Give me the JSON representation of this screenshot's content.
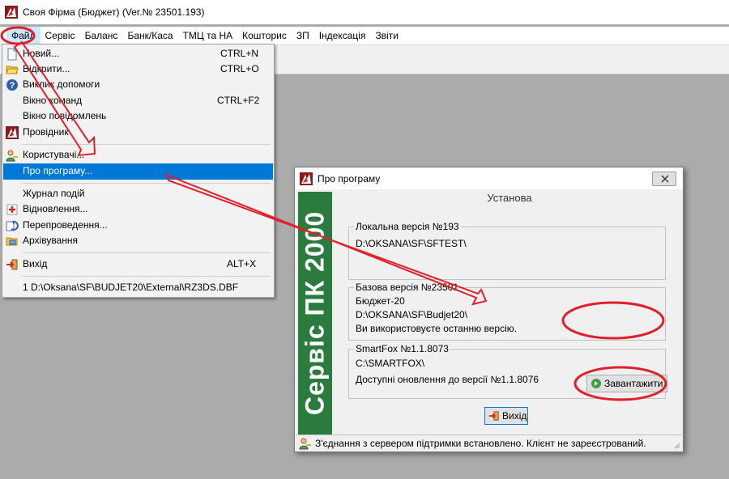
{
  "colors": {
    "highlight": "#0078d7",
    "banner_green": "#2b7a3e",
    "annotation_red": "#e0202a",
    "background": "#ababab"
  },
  "window": {
    "title": "Своя Фірма (Бюджет) (Ver.№ 23501.193)",
    "icon": "app-logo-icon"
  },
  "menubar": {
    "items": [
      {
        "label": "Файл",
        "active": true
      },
      {
        "label": "Сервіс"
      },
      {
        "label": "Баланс"
      },
      {
        "label": "Банк/Каса"
      },
      {
        "label": "ТМЦ та НА"
      },
      {
        "label": "Кошторис"
      },
      {
        "label": "ЗП"
      },
      {
        "label": "Індексація"
      },
      {
        "label": "Звіти"
      }
    ]
  },
  "file_menu": {
    "items": [
      {
        "label": "Новий...",
        "shortcut": "CTRL+N",
        "icon": "new-document-icon"
      },
      {
        "label": "Відкрити...",
        "shortcut": "CTRL+O",
        "icon": "open-folder-icon"
      },
      {
        "label": "Виклик допомоги",
        "shortcut": "",
        "icon": "help-icon"
      },
      {
        "label": "Вікно команд",
        "shortcut": "CTRL+F2",
        "icon": ""
      },
      {
        "label": "Вікно повідомлень",
        "shortcut": "",
        "icon": ""
      },
      {
        "label": "Провідник",
        "shortcut": "",
        "icon": "app-logo-icon"
      },
      {
        "label": "Користувачі...",
        "shortcut": "",
        "icon": "users-icon"
      },
      {
        "label": "Про програму...",
        "shortcut": "",
        "icon": "",
        "highlighted": true
      },
      {
        "label": "Журнал подій",
        "shortcut": "",
        "icon": ""
      },
      {
        "label": "Відновлення...",
        "shortcut": "",
        "icon": "restore-icon"
      },
      {
        "label": "Перепроведення...",
        "shortcut": "",
        "icon": "repost-icon"
      },
      {
        "label": "Архівування",
        "shortcut": "",
        "icon": "archive-icon"
      },
      {
        "label": "Вихід",
        "shortcut": "ALT+X",
        "icon": "exit-icon"
      },
      {
        "label": "1 D:\\Oksana\\SF\\BUDJET20\\External\\RZ3DS.DBF",
        "shortcut": "",
        "icon": ""
      }
    ]
  },
  "about_dialog": {
    "title": "Про програму",
    "banner_text": "Сервіс ПК 2000",
    "heading": "Установа",
    "local": {
      "label": "Локальна версія №193",
      "path": "D:\\OKSANA\\SF\\SFTEST\\"
    },
    "base": {
      "label": "Базова версія №23501",
      "name": "Бюджет-20",
      "path": "D:\\OKSANA\\SF\\Budjet20\\",
      "status": "Ви використовуєте останню версію."
    },
    "smartfox": {
      "label": "SmartFox №1.1.8073",
      "path": "C:\\SMARTFOX\\",
      "update_text": "Доступні оновлення до версії №1.1.8076",
      "download_button": "Завантажити"
    },
    "exit_button": "Вихід",
    "status_text": "З'єднання з сервером підтримки встановлено. Клієнт не зареєстрований."
  }
}
